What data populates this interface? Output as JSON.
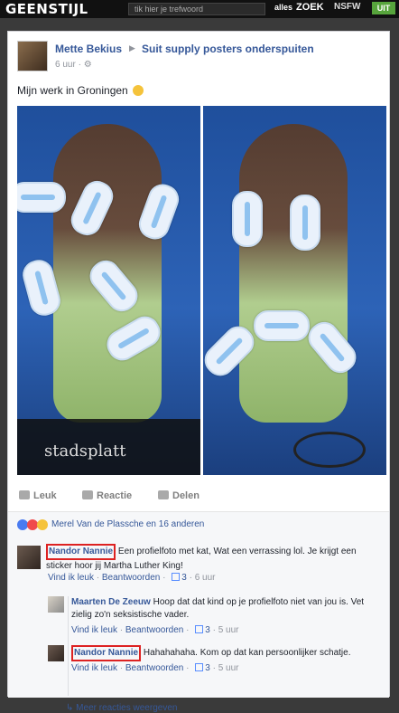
{
  "topbar": {
    "logo": "GEENSTIJL",
    "search_placeholder": "tik hier je trefwoord",
    "alles_label": "alles",
    "zoek_label": "ZOEK",
    "nsfw_label": "NSFW",
    "uit_label": "UIT"
  },
  "post": {
    "author": "Mette Bekius",
    "group": "Suit supply posters onderspuiten",
    "time": "6 uur",
    "text": "Mijn werk in Groningen",
    "photo_text": "stadsplatt"
  },
  "actions": {
    "like": "Leuk",
    "comment": "Reactie",
    "share": "Delen"
  },
  "reactions": {
    "text": "Merel Van de Plassche en 16 anderen"
  },
  "comments": [
    {
      "name": "Nandor Nannie",
      "text": "Een profielfoto met kat, Wat een verrassing lol. Je krijgt een sticker hoor jij Martha Luther King!",
      "like_label": "Vind ik leuk",
      "reply_label": "Beantwoorden",
      "likes": "3",
      "time": "6 uur"
    }
  ],
  "replies": [
    {
      "name": "Maarten De Zeeuw",
      "text": "Hoop dat dat kind op je profielfoto niet van jou is. Vet zielig zo'n seksistische vader.",
      "like_label": "Vind ik leuk",
      "reply_label": "Beantwoorden",
      "likes": "3",
      "time": "5 uur"
    },
    {
      "name": "Nandor Nannie",
      "text": "Hahahahaha. Kom op dat kan persoonlijker schatje.",
      "like_label": "Vind ik leuk",
      "reply_label": "Beantwoorden",
      "likes": "3",
      "time": "5 uur"
    }
  ],
  "more_replies": "Meer reacties weergeven",
  "colors": {
    "link_blue": "#365899",
    "highlight_red": "#dd2222",
    "uit_green": "#57a43c"
  }
}
